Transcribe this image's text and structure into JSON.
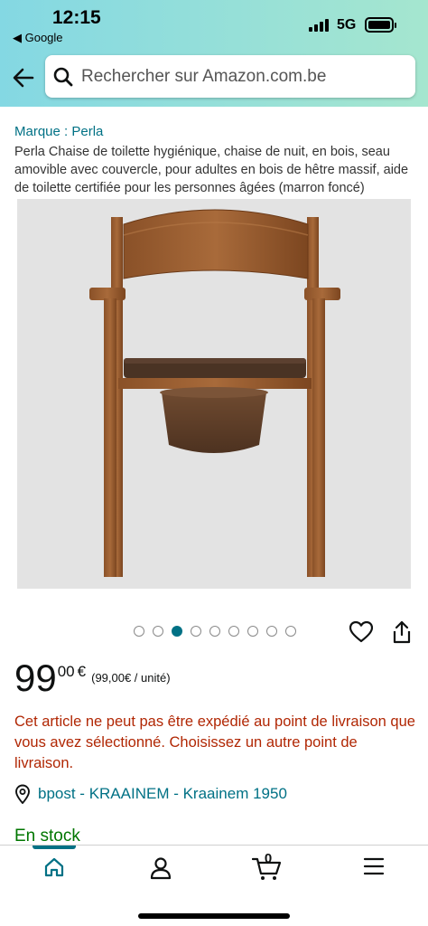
{
  "status_bar": {
    "time": "12:15",
    "back_app": "◀ Google",
    "network": "5G"
  },
  "header": {
    "back_icon": "back-arrow-icon",
    "search": {
      "placeholder": "Rechercher sur Amazon.com.be",
      "icon": "search-icon"
    }
  },
  "product": {
    "brand_link": "Marque : Perla",
    "title": "Perla Chaise de toilette hygiénique, chaise de nuit, en bois, seau amovible avec couvercle, pour adultes en bois de hêtre massif, aide de toilette certifiée pour les personnes âgées (marron foncé)",
    "image_count": 9,
    "active_image_index": 2,
    "price": {
      "whole": "99",
      "fraction": "00",
      "currency": "€",
      "unit_price": "(99,00€ / unité)"
    },
    "delivery_warning": "Cet article ne peut pas être expédié au point de livraison que vous avez sélectionné. Choisissez un autre point de livraison.",
    "delivery_location": "bpost - KRAAINEM - Kraainem 1950",
    "stock": "En stock"
  },
  "bottom_nav": {
    "items": [
      {
        "icon": "home-icon",
        "active": true
      },
      {
        "icon": "account-icon",
        "active": false
      },
      {
        "icon": "cart-icon",
        "active": false,
        "count": "0"
      },
      {
        "icon": "menu-icon",
        "active": false
      }
    ]
  },
  "colors": {
    "header_gradient_start": "#84d8e3",
    "header_gradient_end": "#a5e6cf",
    "link": "#007185",
    "warning": "#B12704",
    "in_stock": "#007600"
  }
}
